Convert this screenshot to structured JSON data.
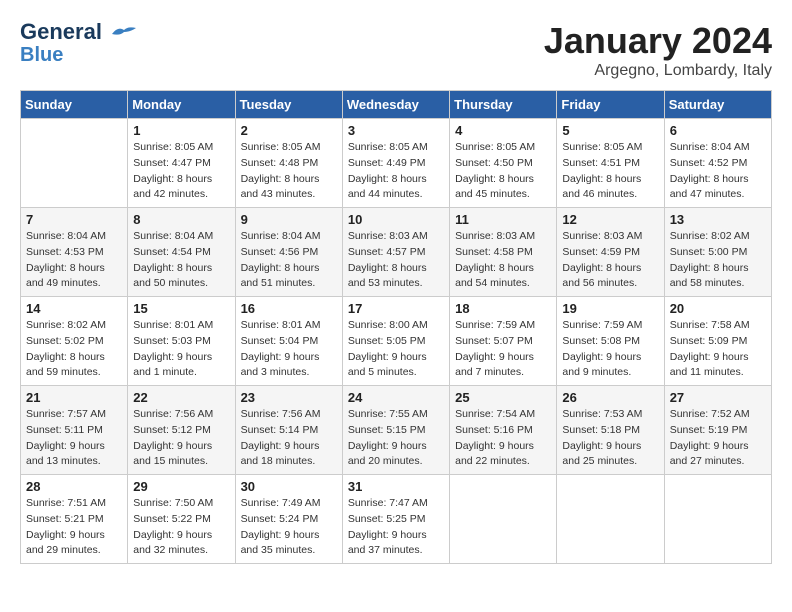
{
  "header": {
    "logo_line1": "General",
    "logo_line2": "Blue",
    "month": "January 2024",
    "location": "Argegno, Lombardy, Italy"
  },
  "weekdays": [
    "Sunday",
    "Monday",
    "Tuesday",
    "Wednesday",
    "Thursday",
    "Friday",
    "Saturday"
  ],
  "weeks": [
    [
      {
        "day": "",
        "sunrise": "",
        "sunset": "",
        "daylight": ""
      },
      {
        "day": "1",
        "sunrise": "Sunrise: 8:05 AM",
        "sunset": "Sunset: 4:47 PM",
        "daylight": "Daylight: 8 hours and 42 minutes."
      },
      {
        "day": "2",
        "sunrise": "Sunrise: 8:05 AM",
        "sunset": "Sunset: 4:48 PM",
        "daylight": "Daylight: 8 hours and 43 minutes."
      },
      {
        "day": "3",
        "sunrise": "Sunrise: 8:05 AM",
        "sunset": "Sunset: 4:49 PM",
        "daylight": "Daylight: 8 hours and 44 minutes."
      },
      {
        "day": "4",
        "sunrise": "Sunrise: 8:05 AM",
        "sunset": "Sunset: 4:50 PM",
        "daylight": "Daylight: 8 hours and 45 minutes."
      },
      {
        "day": "5",
        "sunrise": "Sunrise: 8:05 AM",
        "sunset": "Sunset: 4:51 PM",
        "daylight": "Daylight: 8 hours and 46 minutes."
      },
      {
        "day": "6",
        "sunrise": "Sunrise: 8:04 AM",
        "sunset": "Sunset: 4:52 PM",
        "daylight": "Daylight: 8 hours and 47 minutes."
      }
    ],
    [
      {
        "day": "7",
        "sunrise": "Sunrise: 8:04 AM",
        "sunset": "Sunset: 4:53 PM",
        "daylight": "Daylight: 8 hours and 49 minutes."
      },
      {
        "day": "8",
        "sunrise": "Sunrise: 8:04 AM",
        "sunset": "Sunset: 4:54 PM",
        "daylight": "Daylight: 8 hours and 50 minutes."
      },
      {
        "day": "9",
        "sunrise": "Sunrise: 8:04 AM",
        "sunset": "Sunset: 4:56 PM",
        "daylight": "Daylight: 8 hours and 51 minutes."
      },
      {
        "day": "10",
        "sunrise": "Sunrise: 8:03 AM",
        "sunset": "Sunset: 4:57 PM",
        "daylight": "Daylight: 8 hours and 53 minutes."
      },
      {
        "day": "11",
        "sunrise": "Sunrise: 8:03 AM",
        "sunset": "Sunset: 4:58 PM",
        "daylight": "Daylight: 8 hours and 54 minutes."
      },
      {
        "day": "12",
        "sunrise": "Sunrise: 8:03 AM",
        "sunset": "Sunset: 4:59 PM",
        "daylight": "Daylight: 8 hours and 56 minutes."
      },
      {
        "day": "13",
        "sunrise": "Sunrise: 8:02 AM",
        "sunset": "Sunset: 5:00 PM",
        "daylight": "Daylight: 8 hours and 58 minutes."
      }
    ],
    [
      {
        "day": "14",
        "sunrise": "Sunrise: 8:02 AM",
        "sunset": "Sunset: 5:02 PM",
        "daylight": "Daylight: 8 hours and 59 minutes."
      },
      {
        "day": "15",
        "sunrise": "Sunrise: 8:01 AM",
        "sunset": "Sunset: 5:03 PM",
        "daylight": "Daylight: 9 hours and 1 minute."
      },
      {
        "day": "16",
        "sunrise": "Sunrise: 8:01 AM",
        "sunset": "Sunset: 5:04 PM",
        "daylight": "Daylight: 9 hours and 3 minutes."
      },
      {
        "day": "17",
        "sunrise": "Sunrise: 8:00 AM",
        "sunset": "Sunset: 5:05 PM",
        "daylight": "Daylight: 9 hours and 5 minutes."
      },
      {
        "day": "18",
        "sunrise": "Sunrise: 7:59 AM",
        "sunset": "Sunset: 5:07 PM",
        "daylight": "Daylight: 9 hours and 7 minutes."
      },
      {
        "day": "19",
        "sunrise": "Sunrise: 7:59 AM",
        "sunset": "Sunset: 5:08 PM",
        "daylight": "Daylight: 9 hours and 9 minutes."
      },
      {
        "day": "20",
        "sunrise": "Sunrise: 7:58 AM",
        "sunset": "Sunset: 5:09 PM",
        "daylight": "Daylight: 9 hours and 11 minutes."
      }
    ],
    [
      {
        "day": "21",
        "sunrise": "Sunrise: 7:57 AM",
        "sunset": "Sunset: 5:11 PM",
        "daylight": "Daylight: 9 hours and 13 minutes."
      },
      {
        "day": "22",
        "sunrise": "Sunrise: 7:56 AM",
        "sunset": "Sunset: 5:12 PM",
        "daylight": "Daylight: 9 hours and 15 minutes."
      },
      {
        "day": "23",
        "sunrise": "Sunrise: 7:56 AM",
        "sunset": "Sunset: 5:14 PM",
        "daylight": "Daylight: 9 hours and 18 minutes."
      },
      {
        "day": "24",
        "sunrise": "Sunrise: 7:55 AM",
        "sunset": "Sunset: 5:15 PM",
        "daylight": "Daylight: 9 hours and 20 minutes."
      },
      {
        "day": "25",
        "sunrise": "Sunrise: 7:54 AM",
        "sunset": "Sunset: 5:16 PM",
        "daylight": "Daylight: 9 hours and 22 minutes."
      },
      {
        "day": "26",
        "sunrise": "Sunrise: 7:53 AM",
        "sunset": "Sunset: 5:18 PM",
        "daylight": "Daylight: 9 hours and 25 minutes."
      },
      {
        "day": "27",
        "sunrise": "Sunrise: 7:52 AM",
        "sunset": "Sunset: 5:19 PM",
        "daylight": "Daylight: 9 hours and 27 minutes."
      }
    ],
    [
      {
        "day": "28",
        "sunrise": "Sunrise: 7:51 AM",
        "sunset": "Sunset: 5:21 PM",
        "daylight": "Daylight: 9 hours and 29 minutes."
      },
      {
        "day": "29",
        "sunrise": "Sunrise: 7:50 AM",
        "sunset": "Sunset: 5:22 PM",
        "daylight": "Daylight: 9 hours and 32 minutes."
      },
      {
        "day": "30",
        "sunrise": "Sunrise: 7:49 AM",
        "sunset": "Sunset: 5:24 PM",
        "daylight": "Daylight: 9 hours and 35 minutes."
      },
      {
        "day": "31",
        "sunrise": "Sunrise: 7:47 AM",
        "sunset": "Sunset: 5:25 PM",
        "daylight": "Daylight: 9 hours and 37 minutes."
      },
      {
        "day": "",
        "sunrise": "",
        "sunset": "",
        "daylight": ""
      },
      {
        "day": "",
        "sunrise": "",
        "sunset": "",
        "daylight": ""
      },
      {
        "day": "",
        "sunrise": "",
        "sunset": "",
        "daylight": ""
      }
    ]
  ]
}
